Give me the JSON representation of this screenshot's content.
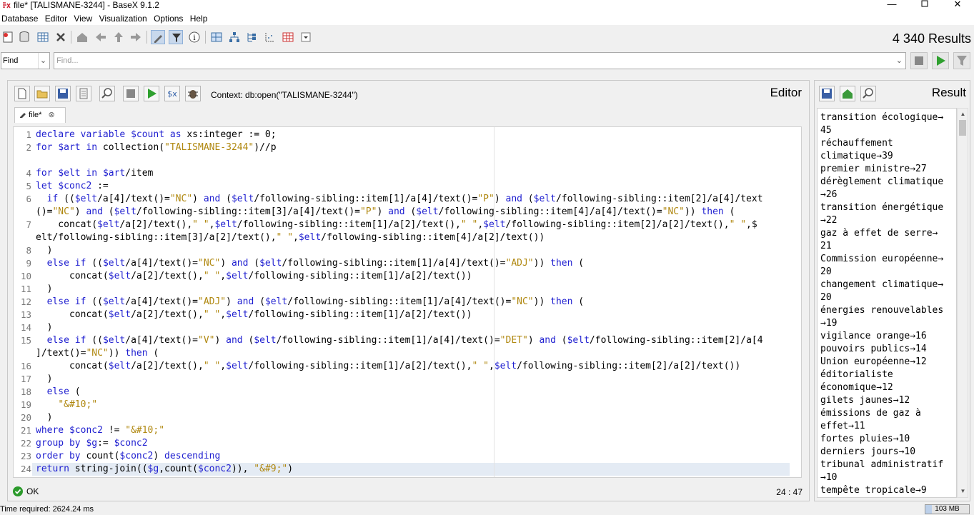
{
  "window": {
    "title": "file* [TALISMANE-3244] - BaseX 9.1.2"
  },
  "menu": [
    "Database",
    "Editor",
    "View",
    "Visualization",
    "Options",
    "Help"
  ],
  "toolbar": {
    "results": "4 340 Results",
    "icons": [
      "new-database",
      "open-database",
      "manage",
      "close",
      "home",
      "back",
      "up",
      "forward",
      "filter",
      "filter-active",
      "info",
      "map",
      "tree",
      "folder",
      "plot",
      "table",
      "dropdown"
    ]
  },
  "find": {
    "mode": "Find",
    "placeholder": "Find..."
  },
  "editor": {
    "label": "Editor",
    "context": "Context: db:open(\"TALISMANE-3244\")",
    "tab": "file*",
    "status": "OK",
    "cursor": "24 : 47",
    "line_numbers": [
      "1",
      "2",
      "",
      "4",
      "5",
      "6",
      "",
      "7",
      "",
      "8",
      "9",
      "10",
      "11",
      "12",
      "13",
      "14",
      "15",
      "",
      "16",
      "17",
      "18",
      "19",
      "20",
      "21",
      "22",
      "23",
      "24"
    ],
    "code": [
      "declare variable $count as xs:integer := 0;",
      "for $art in collection(\"TALISMANE-3244\")//p",
      "",
      "for $elt in $art/item",
      "let $conc2 :=",
      "  if (($elt/a[4]/text()=\"NC\") and ($elt/following-sibling::item[1]/a[4]/text()=\"P\") and ($elt/following-sibling::item[2]/a[4]/text",
      "()=\"NC\") and ($elt/following-sibling::item[3]/a[4]/text()=\"P\") and ($elt/following-sibling::item[4]/a[4]/text()=\"NC\")) then (",
      "    concat($elt/a[2]/text(),\" \",$elt/following-sibling::item[1]/a[2]/text(),\" \",$elt/following-sibling::item[2]/a[2]/text(),\" \",$",
      "elt/following-sibling::item[3]/a[2]/text(),\" \",$elt/following-sibling::item[4]/a[2]/text())",
      "  )",
      "  else if (($elt/a[4]/text()=\"NC\") and ($elt/following-sibling::item[1]/a[4]/text()=\"ADJ\")) then (",
      "      concat($elt/a[2]/text(),\" \",$elt/following-sibling::item[1]/a[2]/text())",
      "  )",
      "  else if (($elt/a[4]/text()=\"ADJ\") and ($elt/following-sibling::item[1]/a[4]/text()=\"NC\")) then (",
      "      concat($elt/a[2]/text(),\" \",$elt/following-sibling::item[1]/a[2]/text())",
      "  )",
      "  else if (($elt/a[4]/text()=\"V\") and ($elt/following-sibling::item[1]/a[4]/text()=\"DET\") and ($elt/following-sibling::item[2]/a[4",
      "]/text()=\"NC\")) then (",
      "      concat($elt/a[2]/text(),\" \",$elt/following-sibling::item[1]/a[2]/text(),\" \",$elt/following-sibling::item[2]/a[2]/text())",
      "  )",
      "  else (",
      "    \"&#10;\"",
      "  )",
      "where $conc2 != \"&#10;\"",
      "group by $g:= $conc2",
      "order by count($conc2) descending",
      "return string-join(($g,count($conc2)), \"&#9;\")"
    ]
  },
  "result": {
    "label": "Result",
    "lines": [
      "transition écologique→",
      "45",
      "réchauffement",
      "climatique→39",
      "premier ministre→27",
      "dérèglement climatique",
      "→26",
      "transition énergétique",
      "→22",
      "gaz à effet de serre→",
      "21",
      "Commission européenne→",
      "20",
      "changement climatique→",
      "20",
      "énergies renouvelables",
      "→19",
      "vigilance orange→16",
      "pouvoirs publics→14",
      "Union européenne→12",
      "éditorialiste",
      "économique→12",
      "gilets jaunes→12",
      "émissions de gaz à",
      "effet→11",
      "fortes pluies→10",
      "derniers jours→10",
      "tribunal administratif",
      "→10",
      "tempête tropicale→9"
    ]
  },
  "footer": {
    "time": "Time required: 2624.24 ms",
    "memory": "103 MB",
    "memory_fraction": 0.15
  }
}
